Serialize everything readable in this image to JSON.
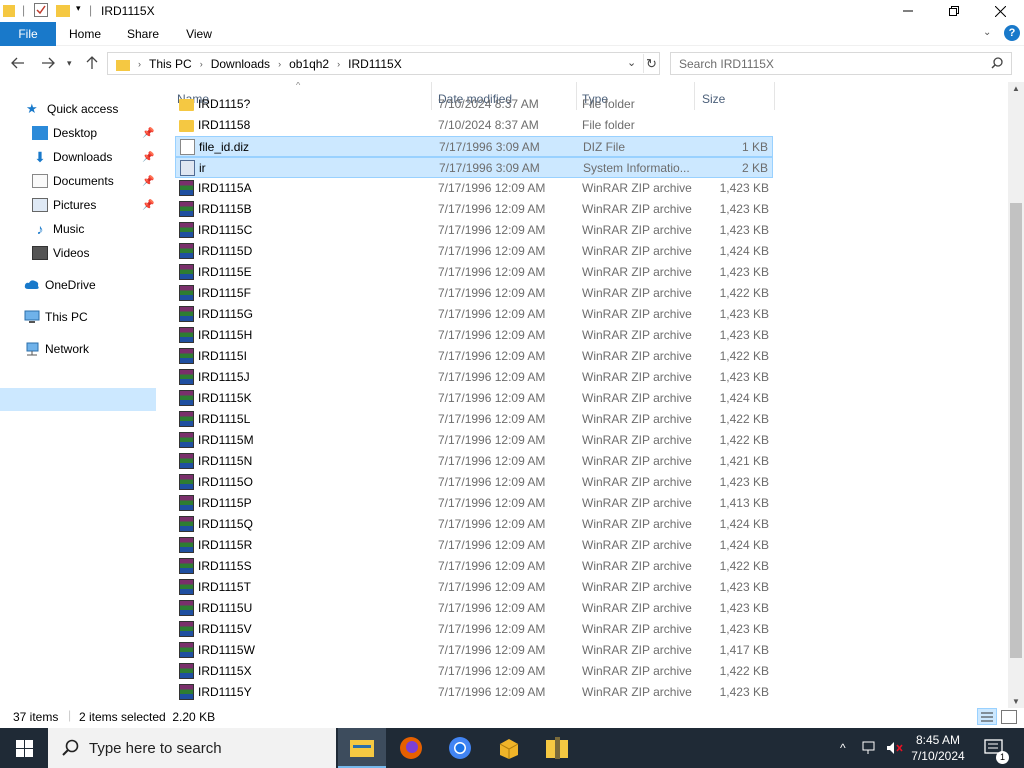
{
  "window": {
    "title": "IRD1115X"
  },
  "ribbon": {
    "tabs": [
      "File",
      "Home",
      "Share",
      "View"
    ]
  },
  "address": {
    "crumbs": [
      "This PC",
      "Downloads",
      "ob1qh2",
      "IRD1115X"
    ]
  },
  "search": {
    "placeholder": "Search IRD1115X"
  },
  "nav": {
    "quick_access": "Quick access",
    "items": [
      "Desktop",
      "Downloads",
      "Documents",
      "Pictures",
      "Music",
      "Videos"
    ],
    "onedrive": "OneDrive",
    "thispc": "This PC",
    "network": "Network"
  },
  "columns": {
    "name": "Name",
    "date": "Date modified",
    "type": "Type",
    "size": "Size"
  },
  "rows": [
    {
      "name": "IRD1115?",
      "date": "7/10/2024 8:37 AM",
      "type": "File folder",
      "size": ""
    },
    {
      "name": "IRD11158",
      "date": "7/10/2024 8:37 AM",
      "type": "File folder",
      "size": ""
    },
    {
      "name": "file_id.diz",
      "date": "7/17/1996 3:09 AM",
      "type": "DIZ File",
      "size": "1 KB"
    },
    {
      "name": "ir",
      "date": "7/17/1996 3:09 AM",
      "type": "System Informatio...",
      "size": "2 KB"
    },
    {
      "name": "IRD1115A",
      "date": "7/17/1996 12:09 AM",
      "type": "WinRAR ZIP archive",
      "size": "1,423 KB"
    },
    {
      "name": "IRD1115B",
      "date": "7/17/1996 12:09 AM",
      "type": "WinRAR ZIP archive",
      "size": "1,423 KB"
    },
    {
      "name": "IRD1115C",
      "date": "7/17/1996 12:09 AM",
      "type": "WinRAR ZIP archive",
      "size": "1,423 KB"
    },
    {
      "name": "IRD1115D",
      "date": "7/17/1996 12:09 AM",
      "type": "WinRAR ZIP archive",
      "size": "1,424 KB"
    },
    {
      "name": "IRD1115E",
      "date": "7/17/1996 12:09 AM",
      "type": "WinRAR ZIP archive",
      "size": "1,423 KB"
    },
    {
      "name": "IRD1115F",
      "date": "7/17/1996 12:09 AM",
      "type": "WinRAR ZIP archive",
      "size": "1,422 KB"
    },
    {
      "name": "IRD1115G",
      "date": "7/17/1996 12:09 AM",
      "type": "WinRAR ZIP archive",
      "size": "1,423 KB"
    },
    {
      "name": "IRD1115H",
      "date": "7/17/1996 12:09 AM",
      "type": "WinRAR ZIP archive",
      "size": "1,423 KB"
    },
    {
      "name": "IRD1115I",
      "date": "7/17/1996 12:09 AM",
      "type": "WinRAR ZIP archive",
      "size": "1,422 KB"
    },
    {
      "name": "IRD1115J",
      "date": "7/17/1996 12:09 AM",
      "type": "WinRAR ZIP archive",
      "size": "1,423 KB"
    },
    {
      "name": "IRD1115K",
      "date": "7/17/1996 12:09 AM",
      "type": "WinRAR ZIP archive",
      "size": "1,424 KB"
    },
    {
      "name": "IRD1115L",
      "date": "7/17/1996 12:09 AM",
      "type": "WinRAR ZIP archive",
      "size": "1,422 KB"
    },
    {
      "name": "IRD1115M",
      "date": "7/17/1996 12:09 AM",
      "type": "WinRAR ZIP archive",
      "size": "1,422 KB"
    },
    {
      "name": "IRD1115N",
      "date": "7/17/1996 12:09 AM",
      "type": "WinRAR ZIP archive",
      "size": "1,421 KB"
    },
    {
      "name": "IRD1115O",
      "date": "7/17/1996 12:09 AM",
      "type": "WinRAR ZIP archive",
      "size": "1,423 KB"
    },
    {
      "name": "IRD1115P",
      "date": "7/17/1996 12:09 AM",
      "type": "WinRAR ZIP archive",
      "size": "1,413 KB"
    },
    {
      "name": "IRD1115Q",
      "date": "7/17/1996 12:09 AM",
      "type": "WinRAR ZIP archive",
      "size": "1,424 KB"
    },
    {
      "name": "IRD1115R",
      "date": "7/17/1996 12:09 AM",
      "type": "WinRAR ZIP archive",
      "size": "1,424 KB"
    },
    {
      "name": "IRD1115S",
      "date": "7/17/1996 12:09 AM",
      "type": "WinRAR ZIP archive",
      "size": "1,422 KB"
    },
    {
      "name": "IRD1115T",
      "date": "7/17/1996 12:09 AM",
      "type": "WinRAR ZIP archive",
      "size": "1,423 KB"
    },
    {
      "name": "IRD1115U",
      "date": "7/17/1996 12:09 AM",
      "type": "WinRAR ZIP archive",
      "size": "1,423 KB"
    },
    {
      "name": "IRD1115V",
      "date": "7/17/1996 12:09 AM",
      "type": "WinRAR ZIP archive",
      "size": "1,423 KB"
    },
    {
      "name": "IRD1115W",
      "date": "7/17/1996 12:09 AM",
      "type": "WinRAR ZIP archive",
      "size": "1,417 KB"
    },
    {
      "name": "IRD1115X",
      "date": "7/17/1996 12:09 AM",
      "type": "WinRAR ZIP archive",
      "size": "1,422 KB"
    },
    {
      "name": "IRD1115Y",
      "date": "7/17/1996 12:09 AM",
      "type": "WinRAR ZIP archive",
      "size": "1,423 KB"
    }
  ],
  "status": {
    "count": "37 items",
    "selected": "2 items selected  2.20 KB"
  },
  "taskbar": {
    "search_text": "Type here to search",
    "time": "8:45 AM",
    "date": "7/10/2024",
    "notif_count": "1"
  },
  "colors": {
    "accent": "#1979ca",
    "selection": "#cce8ff",
    "taskbar": "#1f2a36"
  }
}
